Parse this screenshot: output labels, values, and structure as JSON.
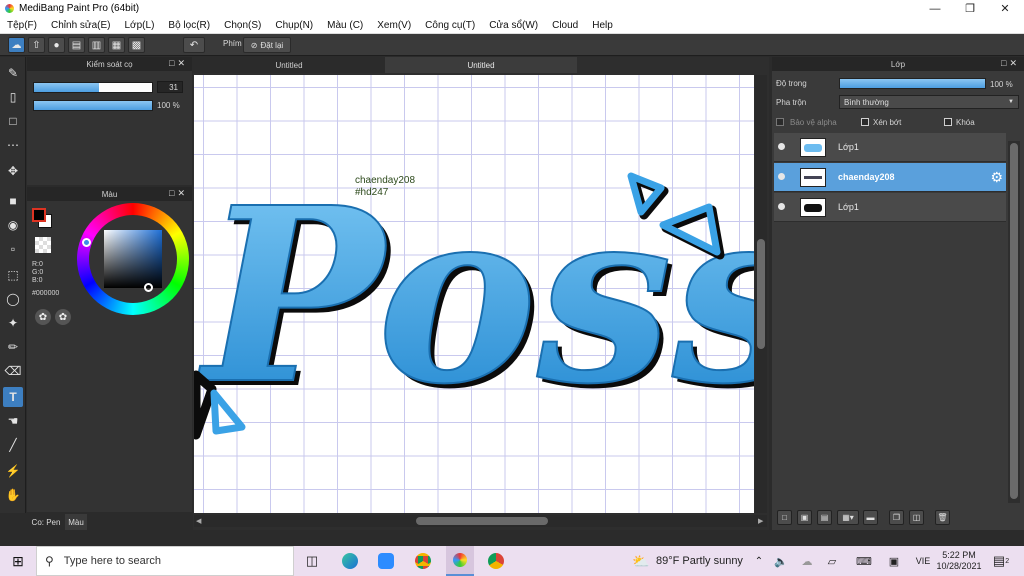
{
  "window": {
    "title": "MediBang Paint Pro (64bit)"
  },
  "menu": [
    "Tệp(F)",
    "Chỉnh sửa(E)",
    "Lớp(L)",
    "Bộ lọc(R)",
    "Chọn(S)",
    "Chụp(N)",
    "Màu (C)",
    "Xem(V)",
    "Công cụ(T)",
    "Cửa sổ(W)",
    "Cloud",
    "Help"
  ],
  "toolbar": {
    "keys_label": "Phím",
    "reset_label": "Đặt lại"
  },
  "brush_panel": {
    "title": "Kiểm soát cọ",
    "size_value": "31",
    "size_fill": 0.55,
    "opacity_value": "100 %",
    "opacity_fill": 1.0
  },
  "color_panel": {
    "title": "Màu",
    "r": "R:0",
    "g": "G:0",
    "b": "B:0",
    "hex": "#000000"
  },
  "bottom_tabs": {
    "pen": "Co: Pen",
    "color": "Màu"
  },
  "doc_tabs": [
    "Untitled",
    "Untitled"
  ],
  "canvas": {
    "line1": "chaenday208",
    "line2": "#hd247",
    "art_text": "Poss"
  },
  "layer_panel": {
    "title": "Lớp",
    "opacity_label": "Độ trong",
    "opacity_value": "100 %",
    "opacity_fill": 1.0,
    "blend_label": "Pha trộn",
    "blend_value": "Bình thường",
    "protect_alpha": "Bảo vệ alpha",
    "clipping": "Xén bớt",
    "lock": "Khóa",
    "layers": [
      {
        "name": "Lớp1",
        "selected": false
      },
      {
        "name": "chaenday208",
        "selected": true
      },
      {
        "name": "Lớp1",
        "selected": false
      }
    ]
  },
  "taskbar": {
    "search_placeholder": "Type here to search",
    "weather": "89°F  Partly sunny",
    "lang": "VIE",
    "time": "5:22 PM",
    "date": "10/28/2021",
    "notif_count": "2"
  },
  "colors": {
    "accent": "#3d7fc1",
    "art_blue": "#3aa2e6",
    "layer_selected": "#5aa0dc"
  }
}
